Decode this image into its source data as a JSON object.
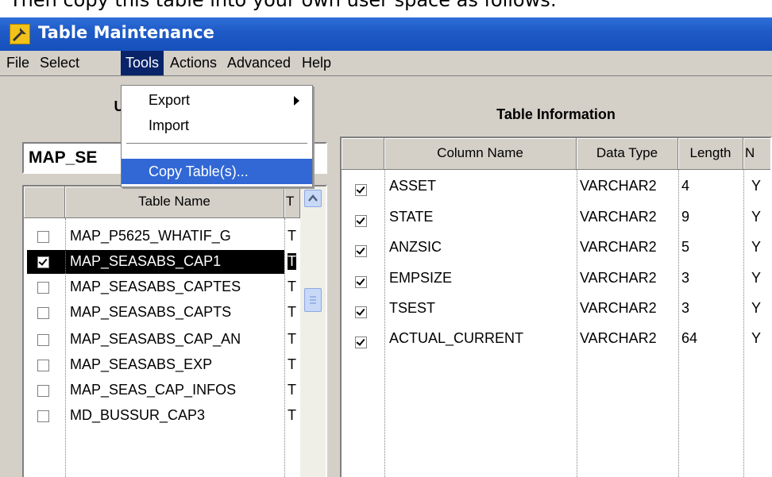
{
  "caption": "Then copy this table into your own user space as follows:",
  "window": {
    "title": "Table Maintenance"
  },
  "menu": {
    "file": "File",
    "select": "Select",
    "tools": "Tools",
    "actions": "Actions",
    "advanced": "Advanced",
    "help": "Help"
  },
  "tools_menu": {
    "export": "Export",
    "import": "Import",
    "copy_tables": "Copy Table(s)..."
  },
  "left_panel": {
    "heading": "Use",
    "user_value": "MAP_SE",
    "columns": {
      "table_name": "Table Name",
      "type": "T"
    },
    "rows": [
      {
        "name": "MAP_P5625_WHATIF_G",
        "type": "T",
        "checked": false,
        "selected": false
      },
      {
        "name": "MAP_SEASABS_CAP1",
        "type": "T",
        "checked": true,
        "selected": true
      },
      {
        "name": "MAP_SEASABS_CAPTES",
        "type": "T",
        "checked": false,
        "selected": false
      },
      {
        "name": "MAP_SEASABS_CAPTS",
        "type": "T",
        "checked": false,
        "selected": false
      },
      {
        "name": "MAP_SEASABS_CAP_AN",
        "type": "T",
        "checked": false,
        "selected": false
      },
      {
        "name": "MAP_SEASABS_EXP",
        "type": "T",
        "checked": false,
        "selected": false
      },
      {
        "name": "MAP_SEAS_CAP_INFOS",
        "type": "T",
        "checked": false,
        "selected": false
      },
      {
        "name": "MD_BUSSUR_CAP3",
        "type": "T",
        "checked": false,
        "selected": false
      }
    ]
  },
  "right_panel": {
    "heading": "Table Information",
    "columns": {
      "column_name": "Column Name",
      "data_type": "Data Type",
      "length": "Length",
      "nullable": "N"
    },
    "rows": [
      {
        "name": "ASSET",
        "type": "VARCHAR2",
        "length": "4",
        "nullable": "Y",
        "checked": true
      },
      {
        "name": "STATE",
        "type": "VARCHAR2",
        "length": "9",
        "nullable": "Y",
        "checked": true
      },
      {
        "name": "ANZSIC",
        "type": "VARCHAR2",
        "length": "5",
        "nullable": "Y",
        "checked": true
      },
      {
        "name": "EMPSIZE",
        "type": "VARCHAR2",
        "length": "3",
        "nullable": "Y",
        "checked": true
      },
      {
        "name": "TSEST",
        "type": "VARCHAR2",
        "length": "3",
        "nullable": "Y",
        "checked": true
      },
      {
        "name": "ACTUAL_CURRENT",
        "type": "VARCHAR2",
        "length": "64",
        "nullable": "Y",
        "checked": true
      }
    ]
  }
}
